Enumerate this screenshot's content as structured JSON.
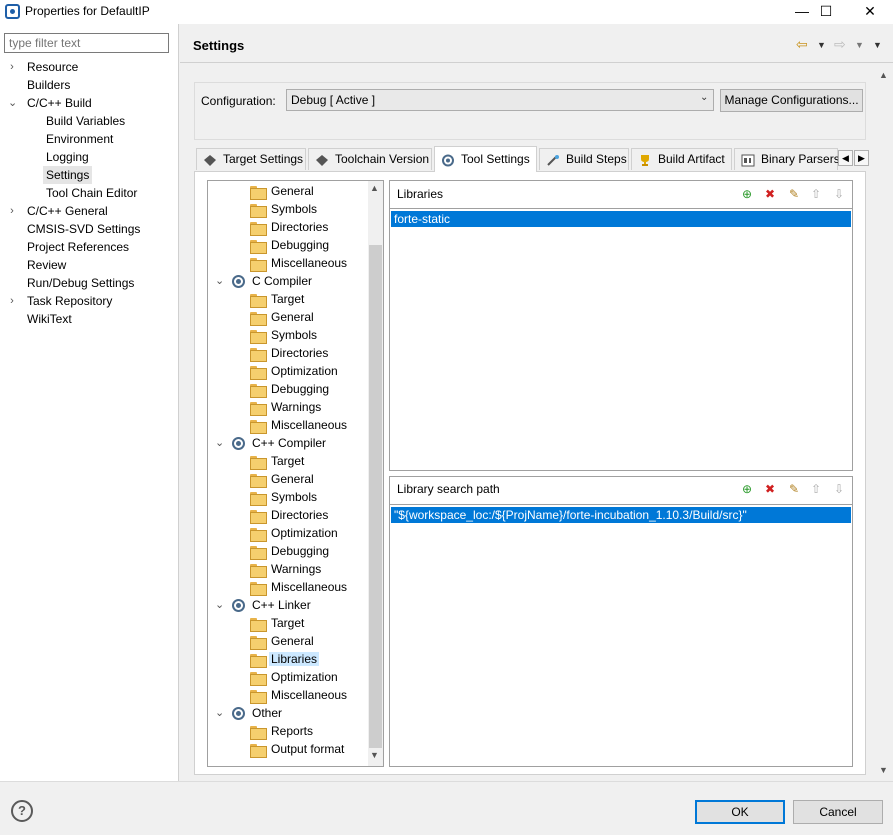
{
  "window": {
    "title": "Properties for DefaultIP",
    "minimize": "—",
    "maximize": "☐",
    "close": "✕"
  },
  "filter": {
    "placeholder": "type filter text"
  },
  "nav": {
    "items": [
      {
        "label": "Resource"
      },
      {
        "label": "Builders"
      },
      {
        "label": "C/C++ Build"
      },
      {
        "label": "Build Variables"
      },
      {
        "label": "Environment"
      },
      {
        "label": "Logging"
      },
      {
        "label": "Settings"
      },
      {
        "label": "Tool Chain Editor"
      },
      {
        "label": "C/C++ General"
      },
      {
        "label": "CMSIS-SVD Settings"
      },
      {
        "label": "Project References"
      },
      {
        "label": "Review"
      },
      {
        "label": "Run/Debug Settings"
      },
      {
        "label": "Task Repository"
      },
      {
        "label": "WikiText"
      }
    ]
  },
  "header": {
    "title": "Settings"
  },
  "configuration": {
    "label": "Configuration:",
    "value": "Debug  [ Active ]",
    "manage_button": "Manage Configurations..."
  },
  "tabs": [
    {
      "label": "Target Settings"
    },
    {
      "label": "Toolchain Version"
    },
    {
      "label": "Tool Settings"
    },
    {
      "label": "Build Steps"
    },
    {
      "label": "Build Artifact"
    },
    {
      "label": "Binary Parsers"
    }
  ],
  "tree": {
    "items": [
      {
        "label": "General"
      },
      {
        "label": "Symbols"
      },
      {
        "label": "Directories"
      },
      {
        "label": "Debugging"
      },
      {
        "label": "Miscellaneous"
      },
      {
        "label": "C Compiler"
      },
      {
        "label": "Target"
      },
      {
        "label": "General"
      },
      {
        "label": "Symbols"
      },
      {
        "label": "Directories"
      },
      {
        "label": "Optimization"
      },
      {
        "label": "Debugging"
      },
      {
        "label": "Warnings"
      },
      {
        "label": "Miscellaneous"
      },
      {
        "label": "C++ Compiler"
      },
      {
        "label": "Target"
      },
      {
        "label": "General"
      },
      {
        "label": "Symbols"
      },
      {
        "label": "Directories"
      },
      {
        "label": "Optimization"
      },
      {
        "label": "Debugging"
      },
      {
        "label": "Warnings"
      },
      {
        "label": "Miscellaneous"
      },
      {
        "label": "C++ Linker"
      },
      {
        "label": "Target"
      },
      {
        "label": "General"
      },
      {
        "label": "Libraries"
      },
      {
        "label": "Optimization"
      },
      {
        "label": "Miscellaneous"
      },
      {
        "label": "Other"
      },
      {
        "label": "Reports"
      },
      {
        "label": "Output format"
      }
    ]
  },
  "libraries": {
    "title": "Libraries",
    "items": [
      "forte-static"
    ]
  },
  "library_search_path": {
    "title": "Library search path",
    "items": [
      "\"${workspace_loc:/${ProjName}/forte-incubation_1.10.3/Build/src}\""
    ]
  },
  "buttons": {
    "ok": "OK",
    "cancel": "Cancel"
  },
  "help": "?"
}
